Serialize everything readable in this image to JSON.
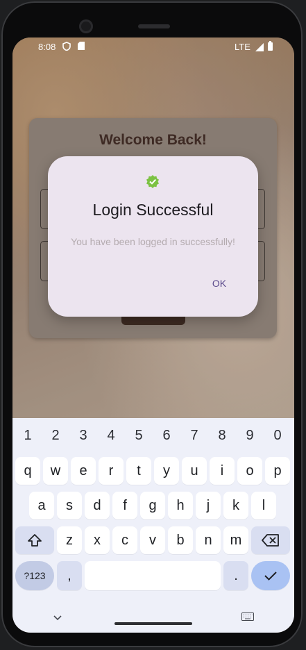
{
  "status": {
    "time": "8:08",
    "network": "LTE"
  },
  "login_card": {
    "title": "Welcome Back!"
  },
  "dialog": {
    "title": "Login Successful",
    "message": "You have been logged in successfully!",
    "ok_label": "OK",
    "check_icon": "verified-check-icon",
    "check_color": "#7cc243"
  },
  "keyboard": {
    "numbers": [
      "1",
      "2",
      "3",
      "4",
      "5",
      "6",
      "7",
      "8",
      "9",
      "0"
    ],
    "row1": [
      "q",
      "w",
      "e",
      "r",
      "t",
      "y",
      "u",
      "i",
      "o",
      "p"
    ],
    "row2": [
      "a",
      "s",
      "d",
      "f",
      "g",
      "h",
      "j",
      "k",
      "l"
    ],
    "row3": [
      "z",
      "x",
      "c",
      "v",
      "b",
      "n",
      "m"
    ],
    "sym_label": "?123",
    "comma": ",",
    "period": ".",
    "shift_icon": "shift-icon",
    "backspace_icon": "backspace-icon",
    "enter_icon": "check-icon",
    "hide_icon": "chevron-down-icon",
    "switch_icon": "keyboard-icon"
  },
  "colors": {
    "accent": "#5b4a8c",
    "enter_key": "#a9c2f3",
    "card_title": "#3e2a24"
  }
}
